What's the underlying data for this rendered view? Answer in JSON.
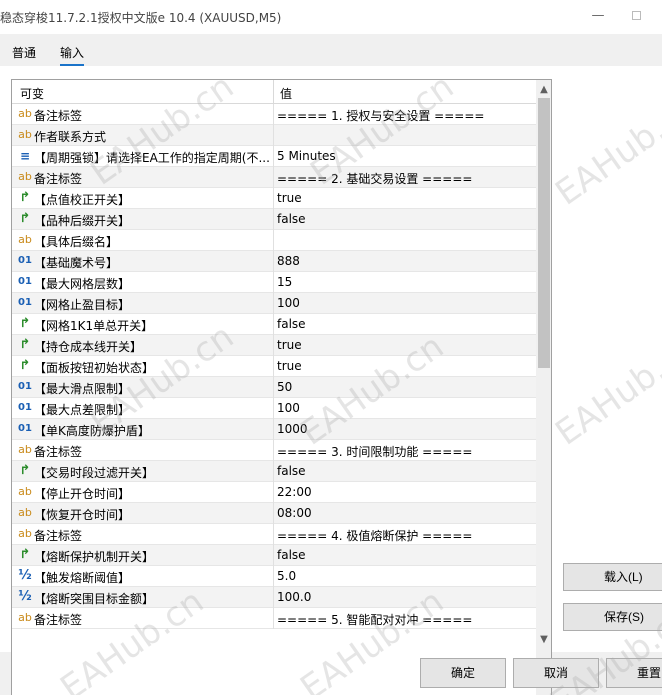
{
  "window": {
    "title": "稳态穿梭11.7.2.1授权中文版e  10.4 (XAUUSD,M5)",
    "minimize": "—"
  },
  "tabs": [
    {
      "label": "普通"
    },
    {
      "label": "输入"
    }
  ],
  "grid": {
    "columns": {
      "variable": "可变",
      "value": "值"
    },
    "rows": [
      {
        "icon": "ab",
        "name": "备注标签",
        "value": "===== 1. 授权与安全设置 ====="
      },
      {
        "icon": "ab",
        "name": "作者联系方式",
        "value": ""
      },
      {
        "icon": "≡",
        "name": "【周期强锁】请选择EA工作的指定周期(不...",
        "value": "5 Minutes"
      },
      {
        "icon": "ab",
        "name": "备注标签",
        "value": "===== 2. 基础交易设置 ====="
      },
      {
        "icon": "↱",
        "name": "【点值校正开关】",
        "value": "true"
      },
      {
        "icon": "↱",
        "name": "【品种后缀开关】",
        "value": "false"
      },
      {
        "icon": "ab",
        "name": "【具体后缀名】",
        "value": ""
      },
      {
        "icon": "01",
        "name": "【基础魔术号】",
        "value": "888"
      },
      {
        "icon": "01",
        "name": "【最大网格层数】",
        "value": "15"
      },
      {
        "icon": "01",
        "name": "【网格止盈目标】",
        "value": "100"
      },
      {
        "icon": "↱",
        "name": "【网格1K1单总开关】",
        "value": "false"
      },
      {
        "icon": "↱",
        "name": "【持仓成本线开关】",
        "value": "true"
      },
      {
        "icon": "↱",
        "name": "【面板按钮初始状态】",
        "value": "true"
      },
      {
        "icon": "01",
        "name": "【最大滑点限制】",
        "value": "50"
      },
      {
        "icon": "01",
        "name": "【最大点差限制】",
        "value": "100"
      },
      {
        "icon": "01",
        "name": "【单K高度防爆护盾】",
        "value": "1000"
      },
      {
        "icon": "ab",
        "name": "备注标签",
        "value": "===== 3. 时间限制功能 ====="
      },
      {
        "icon": "↱",
        "name": "【交易时段过滤开关】",
        "value": "false"
      },
      {
        "icon": "ab",
        "name": "【停止开仓时间】",
        "value": "22:00"
      },
      {
        "icon": "ab",
        "name": "【恢复开仓时间】",
        "value": "08:00"
      },
      {
        "icon": "ab",
        "name": "备注标签",
        "value": "===== 4. 极值熔断保护 ====="
      },
      {
        "icon": "↱",
        "name": "【熔断保护机制开关】",
        "value": "false"
      },
      {
        "icon": "½",
        "name": "【触发熔断阈值】",
        "value": "5.0"
      },
      {
        "icon": "½",
        "name": "【熔断突围目标金额】",
        "value": "100.0"
      },
      {
        "icon": "ab",
        "name": "备注标签",
        "value": "===== 5. 智能配对对冲 ====="
      }
    ]
  },
  "scroll": {
    "up": "▲",
    "down": "▼"
  },
  "buttons": {
    "load": "载入(L)",
    "save": "保存(S)",
    "ok": "确定",
    "cancel": "取消",
    "reset": "重置"
  },
  "watermark": "EAHub.cn"
}
